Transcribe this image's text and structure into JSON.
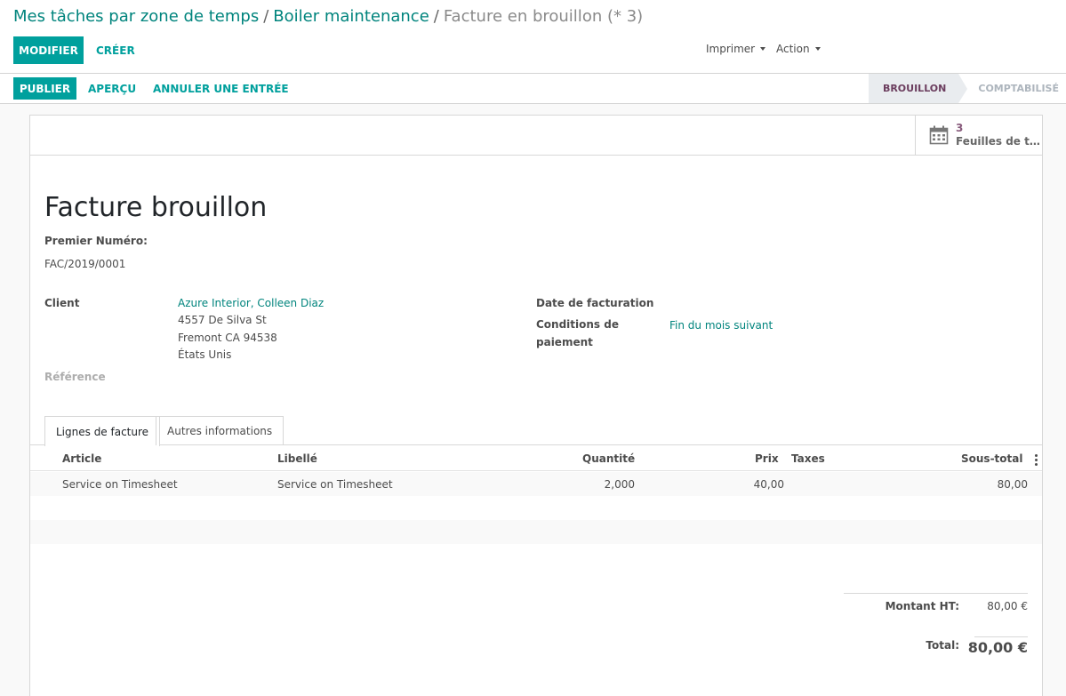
{
  "breadcrumb": {
    "crumb1": "Mes tâches par zone de temps",
    "crumb2": "Boiler maintenance",
    "current": "Facture en brouillon (* 3)",
    "separator": "/"
  },
  "toolbar": {
    "edit_label": "MODIFIER",
    "create_label": "CRÉER",
    "print_label": "Imprimer",
    "action_label": "Action"
  },
  "statusbar": {
    "publish_label": "PUBLIER",
    "preview_label": "APERÇU",
    "cancel_label": "ANNULER UNE ENTRÉE",
    "steps": [
      {
        "label": "BROUILLON",
        "active": true
      },
      {
        "label": "COMPTABILISÉ",
        "active": false
      }
    ]
  },
  "smart_button": {
    "value": "3",
    "label": "Feuilles de temps"
  },
  "form": {
    "title": "Facture brouillon",
    "first_number_label": "Premier Numéro:",
    "first_number_value": "FAC/2019/0001",
    "client_label": "Client",
    "client_name": "Azure Interior, Colleen Diaz",
    "address_line1": "4557 De Silva St",
    "address_line2": "Fremont CA 94538",
    "address_line3": "États Unis",
    "reference_label": "Référence",
    "invoice_date_label": "Date de facturation",
    "payment_terms_label_1": "Conditions de",
    "payment_terms_label_2": "paiement",
    "payment_terms_value": "Fin du mois suivant"
  },
  "tabs": [
    {
      "label": "Lignes de facture",
      "active": true
    },
    {
      "label": "Autres informations",
      "active": false
    }
  ],
  "lines_table": {
    "headers": {
      "article": "Article",
      "label": "Libellé",
      "quantity": "Quantité",
      "price": "Prix",
      "taxes": "Taxes",
      "subtotal": "Sous-total"
    },
    "rows": [
      {
        "article": "Service on Timesheet",
        "label": "Service on Timesheet",
        "quantity": "2,000",
        "price": "40,00",
        "taxes": "",
        "subtotal": "80,00"
      }
    ]
  },
  "totals": {
    "untaxed_label": "Montant HT:",
    "untaxed_value": "80,00 €",
    "total_label": "Total:",
    "total_value": "80,00 €"
  },
  "colors": {
    "primary": "#00a09d",
    "link": "#00847d",
    "status_active": "#6b3d5e",
    "stat_value": "#875a7b"
  }
}
